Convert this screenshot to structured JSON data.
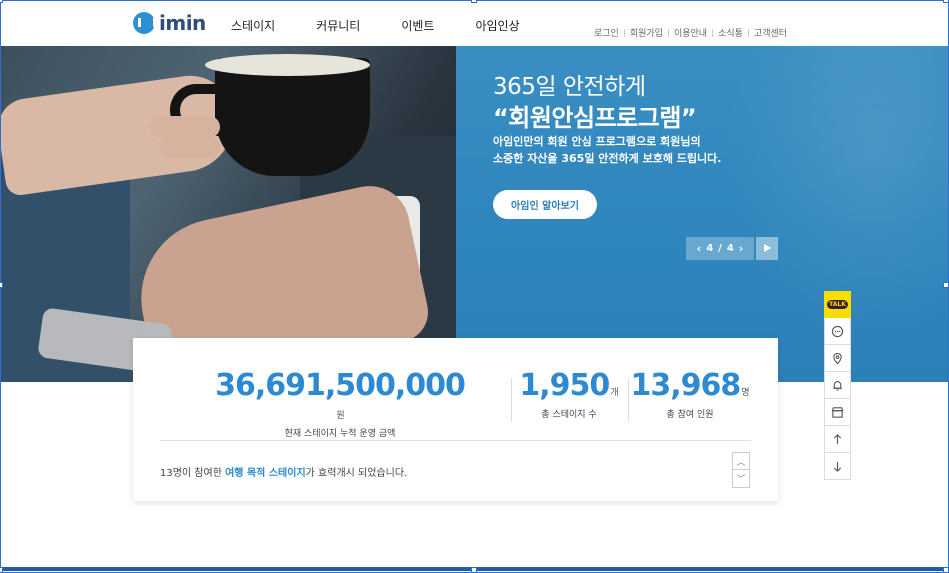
{
  "header": {
    "logo_text": "imin",
    "nav": [
      "스테이지",
      "커뮤니티",
      "이벤트",
      "아임인상"
    ],
    "util": [
      "로그인",
      "회원가입",
      "이용안내",
      "소식통",
      "고객센터"
    ]
  },
  "hero": {
    "subtitle": "365일 안전하게",
    "title": "“회원안심프로그램”",
    "desc_line1": "아임인만의 회원 안심 프로그램으로 회원님의",
    "desc_line2": "소중한 자산을 365일 안전하게 보호해 드립니다.",
    "button_label": "아임인 알아보기",
    "pager_current": "4",
    "pager_sep": "/",
    "pager_total": "4",
    "prev_glyph": "‹",
    "next_glyph": "›"
  },
  "stats": {
    "items": [
      {
        "value": "36,691,500,000",
        "unit": "원",
        "label": "현재 스테이지 누적 운영 금액"
      },
      {
        "value": "1,950",
        "unit": "개",
        "label": "총 스테이지 수"
      },
      {
        "value": "13,968",
        "unit": "명",
        "label": "총 참여 인원"
      }
    ],
    "notice_prefix": "13명이 참여한 ",
    "notice_highlight": "여행 목적 스테이지",
    "notice_suffix": "가 효력개시 되었습니다.",
    "up_glyph": "︿",
    "down_glyph": "﹀"
  },
  "quick": {
    "talk_label": "TALK"
  },
  "colors": {
    "accent": "#2d8ad0",
    "hero_blue": "#2f86bd",
    "kakao_yellow": "#f8de00"
  }
}
